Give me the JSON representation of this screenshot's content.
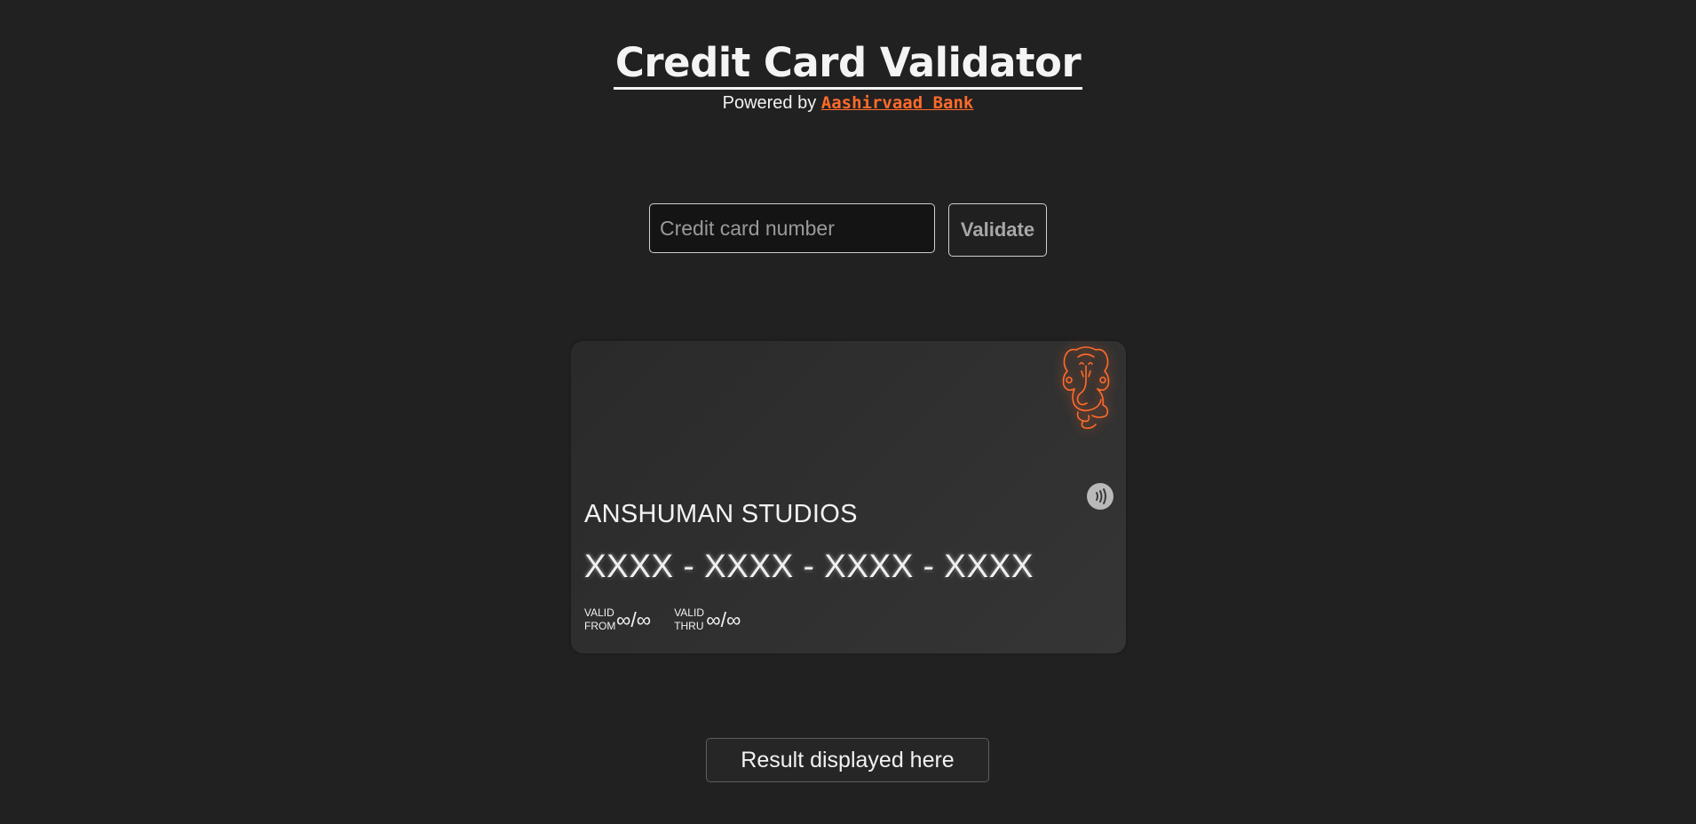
{
  "header": {
    "title": "Credit Card Validator",
    "powered_by": "Powered by ",
    "bank_name": "Aashirvaad Bank"
  },
  "form": {
    "input_placeholder": "Credit card number",
    "input_value": "",
    "validate_label": "Validate"
  },
  "card": {
    "holder": "ANSHUMAN STUDIOS",
    "number": "XXXX - XXXX - XXXX - XXXX",
    "valid_from_label_1": "VALID",
    "valid_from_label_2": "FROM",
    "valid_from_value": "∞/∞",
    "valid_thru_label_1": "VALID",
    "valid_thru_label_2": "THRU",
    "valid_thru_value": "∞/∞",
    "logo_icon": "ganesha-icon",
    "contactless_icon": "contactless-icon"
  },
  "result": {
    "text": "Result displayed here"
  },
  "colors": {
    "background": "#212121",
    "accent": "#ff6b2b",
    "card": "#2f2f2f"
  }
}
